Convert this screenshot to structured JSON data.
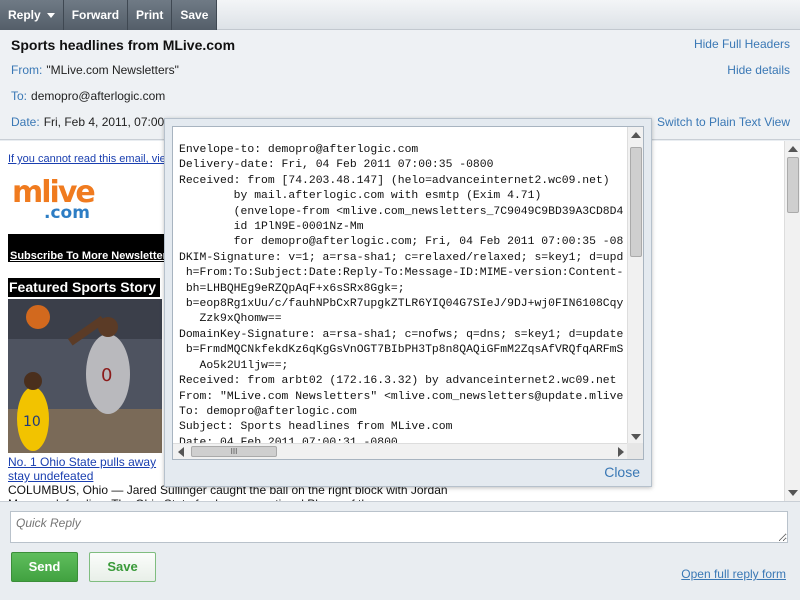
{
  "toolbar": {
    "reply": "Reply",
    "forward": "Forward",
    "print": "Print",
    "save": "Save"
  },
  "headers": {
    "subject": "Sports headlines from MLive.com",
    "from_label": "From:",
    "from_value": "\"MLive.com Newsletters\"",
    "to_label": "To:",
    "to_value": "demopro@afterlogic.com",
    "date_label": "Date:",
    "date_value": "Fri, Feb 4, 2011, 07:00",
    "hide_full_headers": "Hide Full Headers",
    "hide_details": "Hide details",
    "switch_plain": "Switch to Plain Text View"
  },
  "message": {
    "cannot_read": "If you cannot read this email, vie",
    "logo_main": "mlive",
    "logo_sub": ".com",
    "subscribe": "Subscribe To More Newsletter",
    "featured": "Featured Sports Story",
    "story_link": "No. 1 Ohio State pulls away stay undefeated",
    "story_text": "COLUMBUS, Ohio — Jared Sullinger caught the ball on the right block with Jordan Morgan defending. The Ohio State freshman, a national Player of the"
  },
  "full_headers": {
    "text": "Envelope-to: demopro@afterlogic.com\nDelivery-date: Fri, 04 Feb 2011 07:00:35 -0800\nReceived: from [74.203.48.147] (helo=advanceinternet2.wc09.net)\n        by mail.afterlogic.com with esmtp (Exim 4.71)\n        (envelope-from <mlive.com_newsletters_7C9049C9BD39A3CD8D4\n        id 1PlN9E-0001Nz-Mm\n        for demopro@afterlogic.com; Fri, 04 Feb 2011 07:00:35 -08\nDKIM-Signature: v=1; a=rsa-sha1; c=relaxed/relaxed; s=key1; d=upd\n h=From:To:Subject:Date:Reply-To:Message-ID:MIME-version:Content-\n bh=LHBQHEg9eRZQpAqF+x6sSRx8Ggk=;\n b=eop8Rg1xUu/c/fauhNPbCxR7upgkZTLR6YIQ04G7SIeJ/9DJ+wj0FIN6108Cqy\n   Zzk9xQhomw==\nDomainKey-Signature: a=rsa-sha1; c=nofws; q=dns; s=key1; d=update\n b=FrmdMQCNkfekdKz6qKgGsVnOGT7BIbPH3Tp8n8QAQiGFmM2ZqsAfVRQfqARFmS\n   Ao5k2U1ljw==;\nReceived: from arbt02 (172.16.3.32) by advanceinternet2.wc09.net\nFrom: \"MLive.com Newsletters\" <mlive.com_newsletters@update.mlive\nTo: demopro@afterlogic.com\nSubject: Sports headlines from MLive.com\nDate: 04 Feb 2011 07:00:31 -0800",
    "close": "Close",
    "scroll_grip": "III"
  },
  "reply": {
    "placeholder": "Quick Reply",
    "send": "Send",
    "save": "Save",
    "open_full": "Open full reply form"
  }
}
